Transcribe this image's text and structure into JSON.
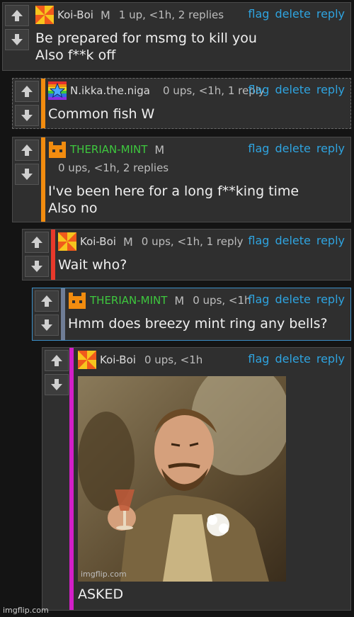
{
  "comments": [
    {
      "username": "Koi-Boi",
      "badge": "M",
      "meta": "1 up, <1h, 2 replies",
      "avatar": "pinwheel-avatar",
      "lines": [
        "Be prepared for msmg to kill you",
        "Also f**k off"
      ]
    },
    {
      "username": "N.ikka.the.niga",
      "badge": "",
      "meta": "0 ups, <1h, 1 reply",
      "avatar": "rainbow-star-avatar",
      "lines": [
        "Common fish W"
      ]
    },
    {
      "username": "THERIAN-MINT",
      "badge": "M",
      "meta": "0 ups, <1h, 2 replies",
      "avatar": "orange-cat-avatar",
      "lines": [
        "I've been here for a long f**king time",
        "Also no"
      ]
    },
    {
      "username": "Koi-Boi",
      "badge": "M",
      "meta": "0 ups, <1h, 1 reply",
      "avatar": "pinwheel-avatar",
      "lines": [
        "Wait who?"
      ]
    },
    {
      "username": "THERIAN-MINT",
      "badge": "M",
      "meta": "0 ups, <1h",
      "avatar": "orange-cat-avatar",
      "lines": [
        "Hmm does breezy mint ring any bells?"
      ]
    },
    {
      "username": "Koi-Boi",
      "badge": "",
      "meta": "0 ups, <1h",
      "avatar": "pinwheel-avatar",
      "image_watermark": "imgflip.com",
      "image_icon": "laughing-man-meme-image",
      "lines": [
        "ASKED"
      ]
    }
  ],
  "actions": {
    "flag": "flag",
    "delete": "delete",
    "reply": "reply"
  },
  "watermark": "imgflip.com",
  "colors": {
    "accent_link": "#2fa4e0",
    "bar_orange": "#f28c0f",
    "bar_red": "#e8392b",
    "bar_slate": "#6f7d96",
    "bar_magenta": "#d21fc8",
    "username_green": "#3ec83e"
  }
}
